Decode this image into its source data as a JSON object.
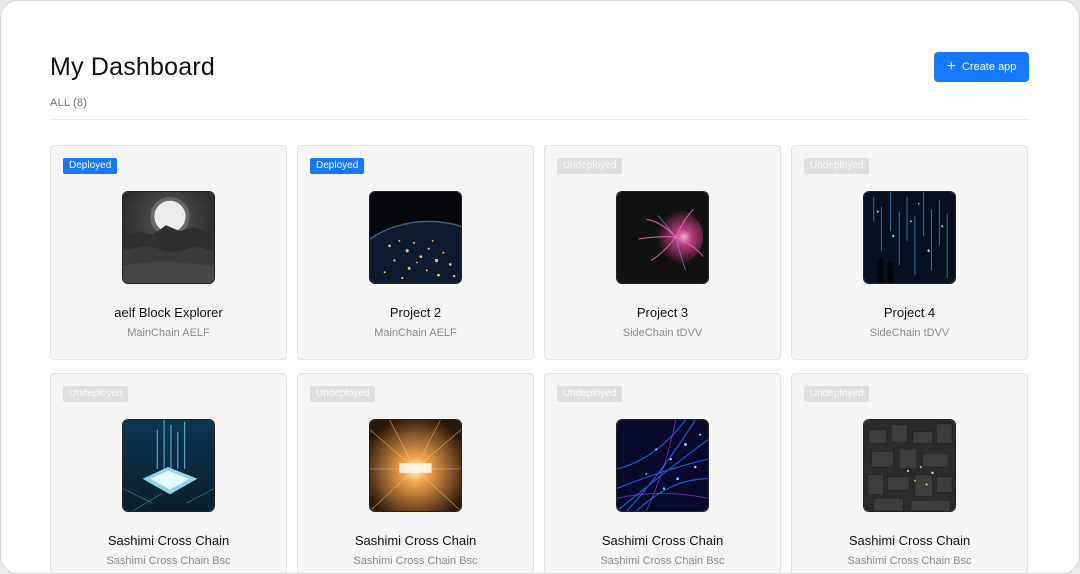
{
  "page": {
    "title": "My Dashboard",
    "filter_label": "ALL (8)",
    "create_button_label": "Create app"
  },
  "colors": {
    "accent": "#1677ff",
    "undeployed_badge": "#dedede"
  },
  "apps": [
    {
      "status": "Deployed",
      "name": "aelf Block Explorer",
      "chain": "MainChain AELF",
      "thumb": "moon-landscape"
    },
    {
      "status": "Deployed",
      "name": "Project 2",
      "chain": "MainChain AELF",
      "thumb": "earth-night"
    },
    {
      "status": "Undeployed",
      "name": "Project 3",
      "chain": "SideChain tDVV",
      "thumb": "plasma-ball"
    },
    {
      "status": "Undeployed",
      "name": "Project 4",
      "chain": "SideChain tDVV",
      "thumb": "light-rain"
    },
    {
      "status": "Undeployed",
      "name": "Sashimi Cross Chain",
      "chain": "Sashimi Cross Chain Bsc",
      "thumb": "chip"
    },
    {
      "status": "Undeployed",
      "name": "Sashimi Cross Chain",
      "chain": "Sashimi Cross Chain Bsc",
      "thumb": "light-tunnel"
    },
    {
      "status": "Undeployed",
      "name": "Sashimi Cross Chain",
      "chain": "Sashimi Cross Chain Bsc",
      "thumb": "fiber-optics"
    },
    {
      "status": "Undeployed",
      "name": "Sashimi Cross Chain",
      "chain": "Sashimi Cross Chain Bsc",
      "thumb": "dark-city"
    }
  ]
}
